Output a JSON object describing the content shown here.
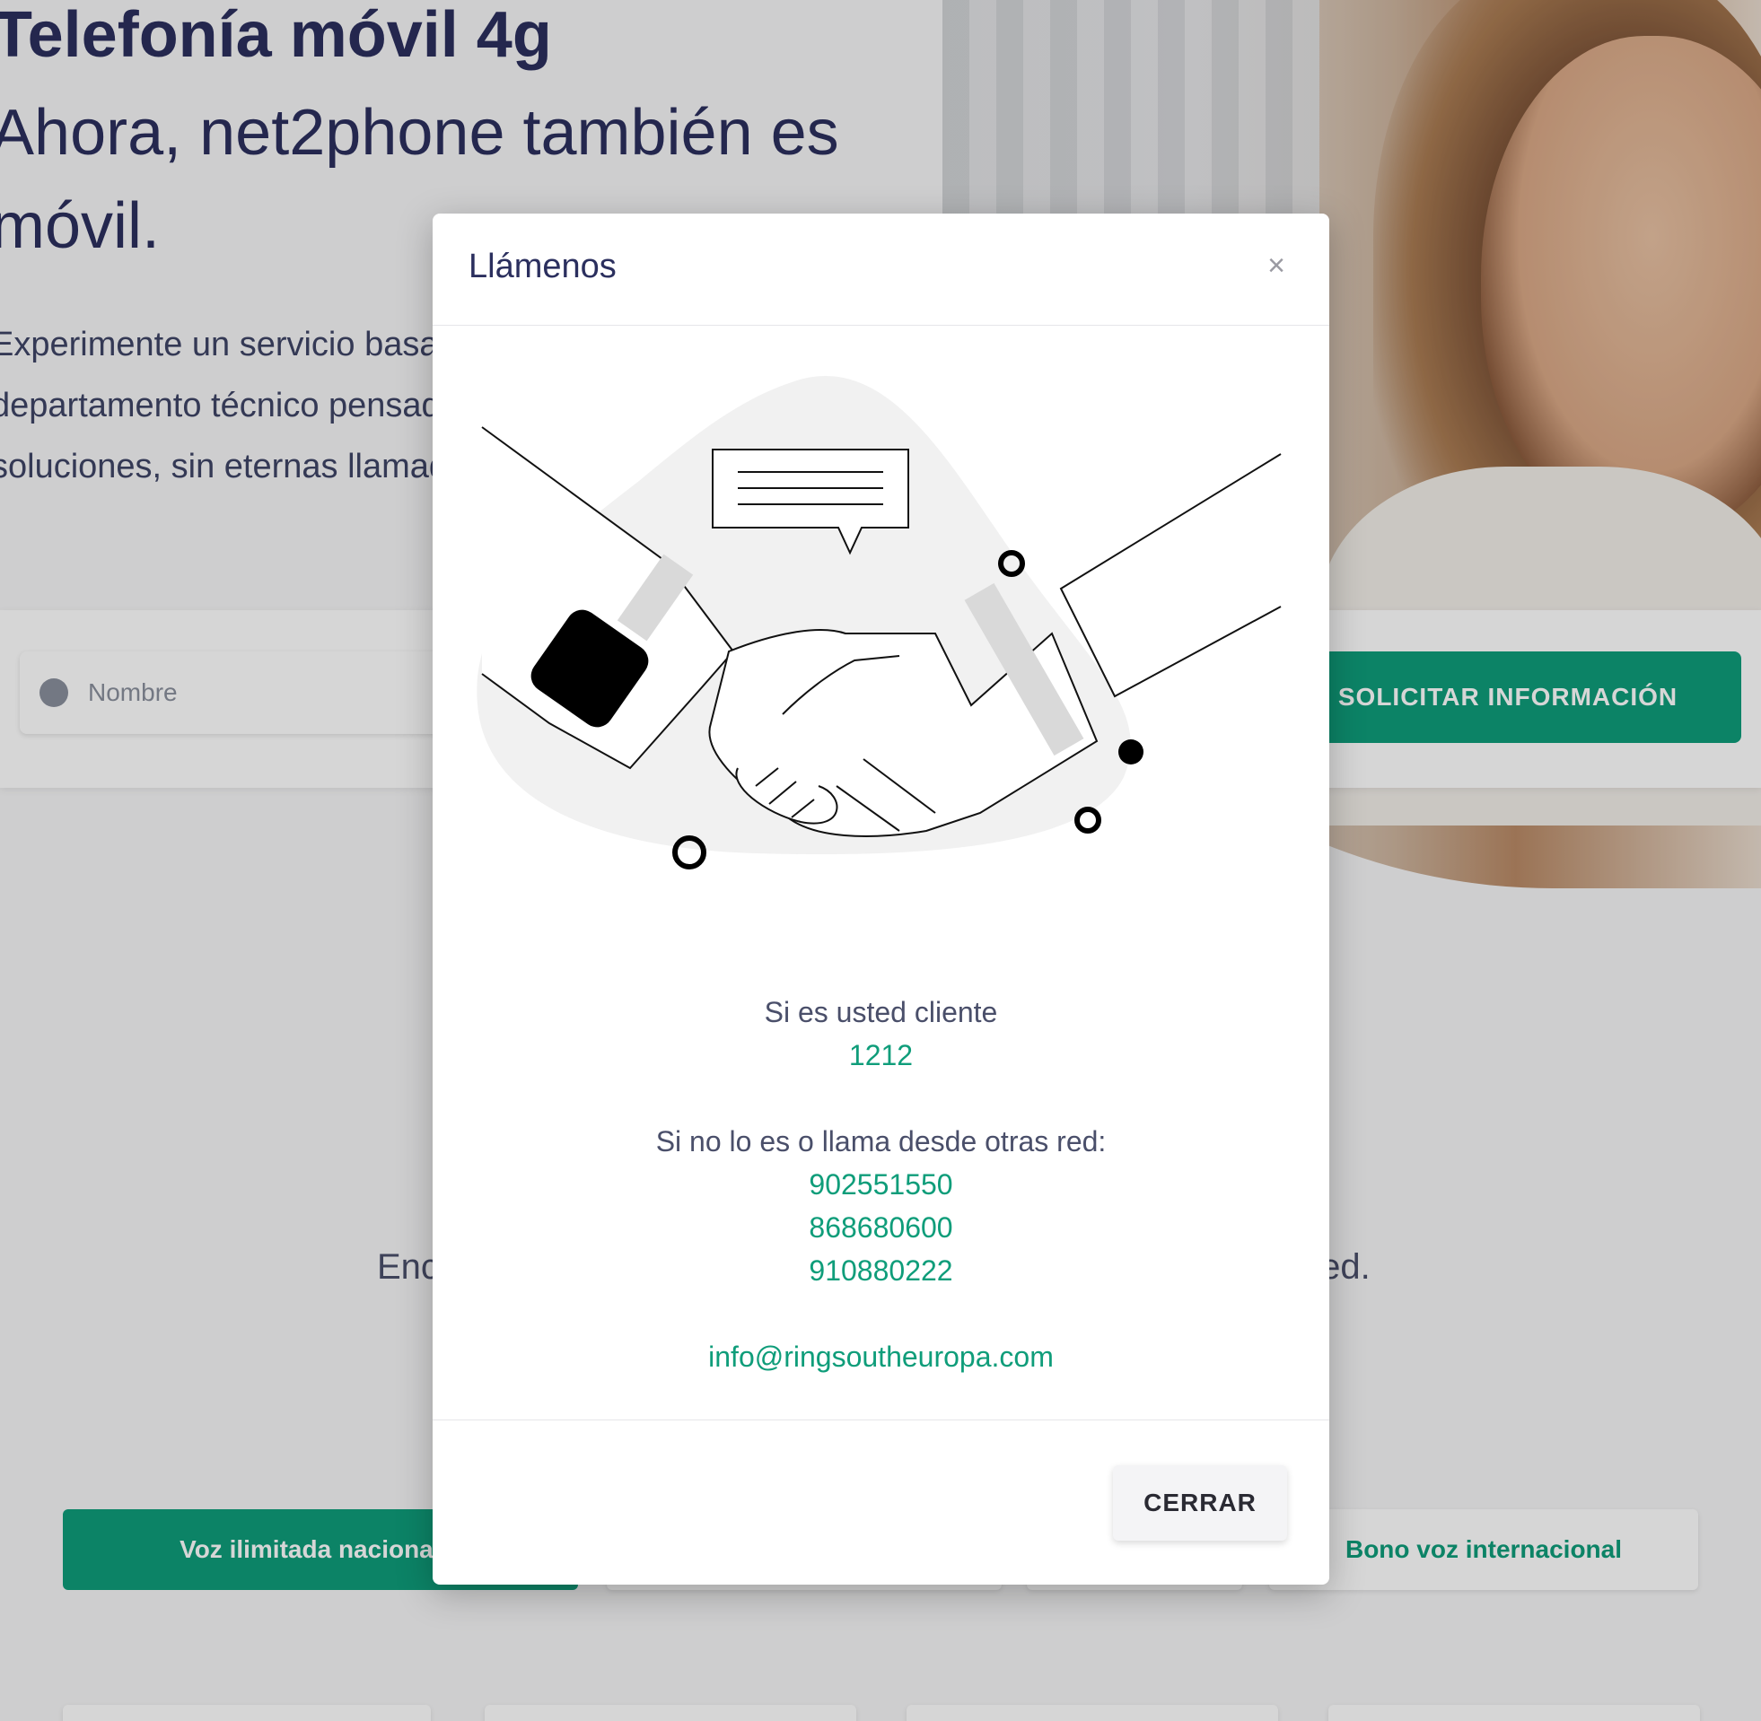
{
  "hero": {
    "title": "Telefonía móvil 4g",
    "subtitle": "Ahora, net2phone también es móvil.",
    "intro": "Experimente un servicio basado en un departamento técnico pensado para soluciones, sin eternas llamadas."
  },
  "form": {
    "name_placeholder": "Nombre",
    "submit_label": "SOLICITAR INFORMACIÓN"
  },
  "section": {
    "subtitle_left": "Enc",
    "subtitle_right": "ted."
  },
  "plan_tabs": [
    {
      "label": "Voz ilimitada nacional y"
    },
    {
      "label": ""
    },
    {
      "label": ""
    },
    {
      "label": "Bono voz internacional"
    }
  ],
  "modal": {
    "title": "Llámenos",
    "close_glyph": "×",
    "client_label": "Si es usted cliente",
    "client_number": "1212",
    "other_label": "Si no lo es o llama desde otras red:",
    "other_numbers": [
      "902551550",
      "868680600",
      "910880222"
    ],
    "email": "info@ringsoutheuropa.com",
    "close_button": "CERRAR"
  },
  "colors": {
    "accent": "#0f9d7a",
    "heading": "#2b2f5e",
    "body_text": "#4a4f6a"
  }
}
